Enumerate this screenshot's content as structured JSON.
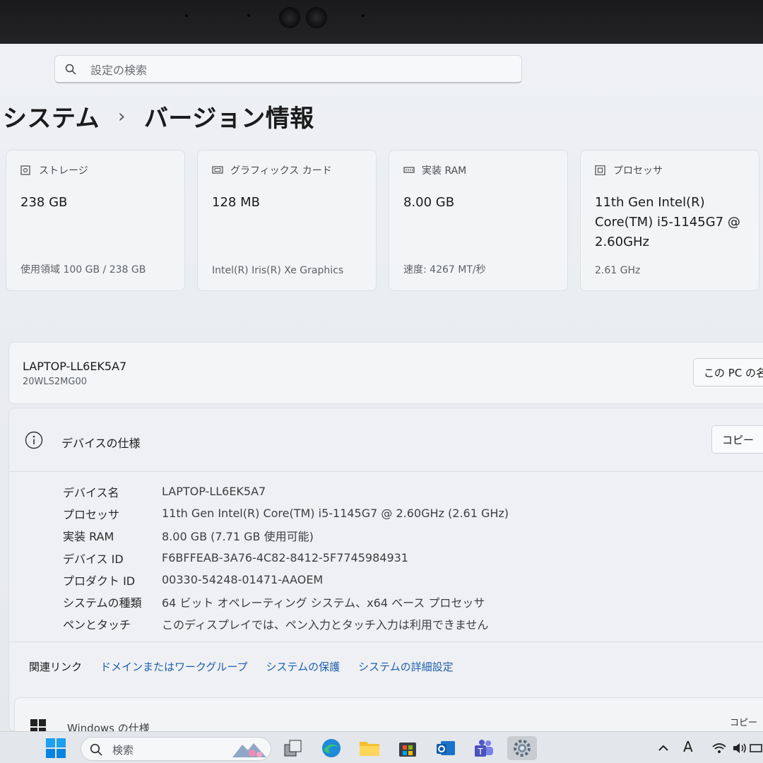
{
  "search": {
    "placeholder": "設定の検索"
  },
  "breadcrumb": {
    "parent": "システム",
    "separator": "›",
    "current": "バージョン情報"
  },
  "cards": [
    {
      "icon": "storage-icon",
      "label": "ストレージ",
      "value": "238 GB",
      "detail": "使用領域 100 GB / 238 GB"
    },
    {
      "icon": "graphics-card-icon",
      "label": "グラフィックス カード",
      "value": "128 MB",
      "detail": "Intel(R) Iris(R) Xe Graphics"
    },
    {
      "icon": "ram-icon",
      "label": "実装 RAM",
      "value": "8.00 GB",
      "detail": "速度: 4267 MT/秒"
    },
    {
      "icon": "processor-icon",
      "label": "プロセッサ",
      "value": "11th Gen Intel(R) Core(TM) i5-1145G7 @ 2.60GHz",
      "detail": "2.61 GHz"
    }
  ],
  "device": {
    "name": "LAPTOP-LL6EK5A7",
    "model": "20WLS2MG00",
    "rename_label": "この PC の名"
  },
  "spec": {
    "title": "デバイスの仕様",
    "copy_label": "コピー",
    "rows": [
      {
        "label": "デバイス名",
        "value": "LAPTOP-LL6EK5A7"
      },
      {
        "label": "プロセッサ",
        "value": "11th Gen Intel(R) Core(TM) i5-1145G7 @ 2.60GHz (2.61 GHz)"
      },
      {
        "label": "実装 RAM",
        "value": "8.00 GB (7.71 GB 使用可能)"
      },
      {
        "label": "デバイス ID",
        "value": "F6BFFEAB-3A76-4C82-8412-5F7745984931"
      },
      {
        "label": "プロダクト ID",
        "value": "00330-54248-01471-AAOEM"
      },
      {
        "label": "システムの種類",
        "value": "64 ビット オペレーティング システム、x64 ベース プロセッサ"
      },
      {
        "label": "ペンとタッチ",
        "value": "このディスプレイでは、ペン入力とタッチ入力は利用できません"
      }
    ],
    "related_label": "関連リンク",
    "links": [
      "ドメインまたはワークグループ",
      "システムの保護",
      "システムの詳細設定"
    ]
  },
  "windows_spec": {
    "title": "Windows の仕様",
    "copy_label": "コピー"
  },
  "taskbar": {
    "search_placeholder": "検索",
    "ime_indicator": "A",
    "icons": [
      "start-icon",
      "task-view-icon",
      "edge-icon",
      "file-explorer-icon",
      "store-icon",
      "outlook-icon",
      "teams-icon",
      "settings-icon"
    ]
  },
  "colors": {
    "link": "#1f5fae",
    "accent": "#0067c0"
  }
}
